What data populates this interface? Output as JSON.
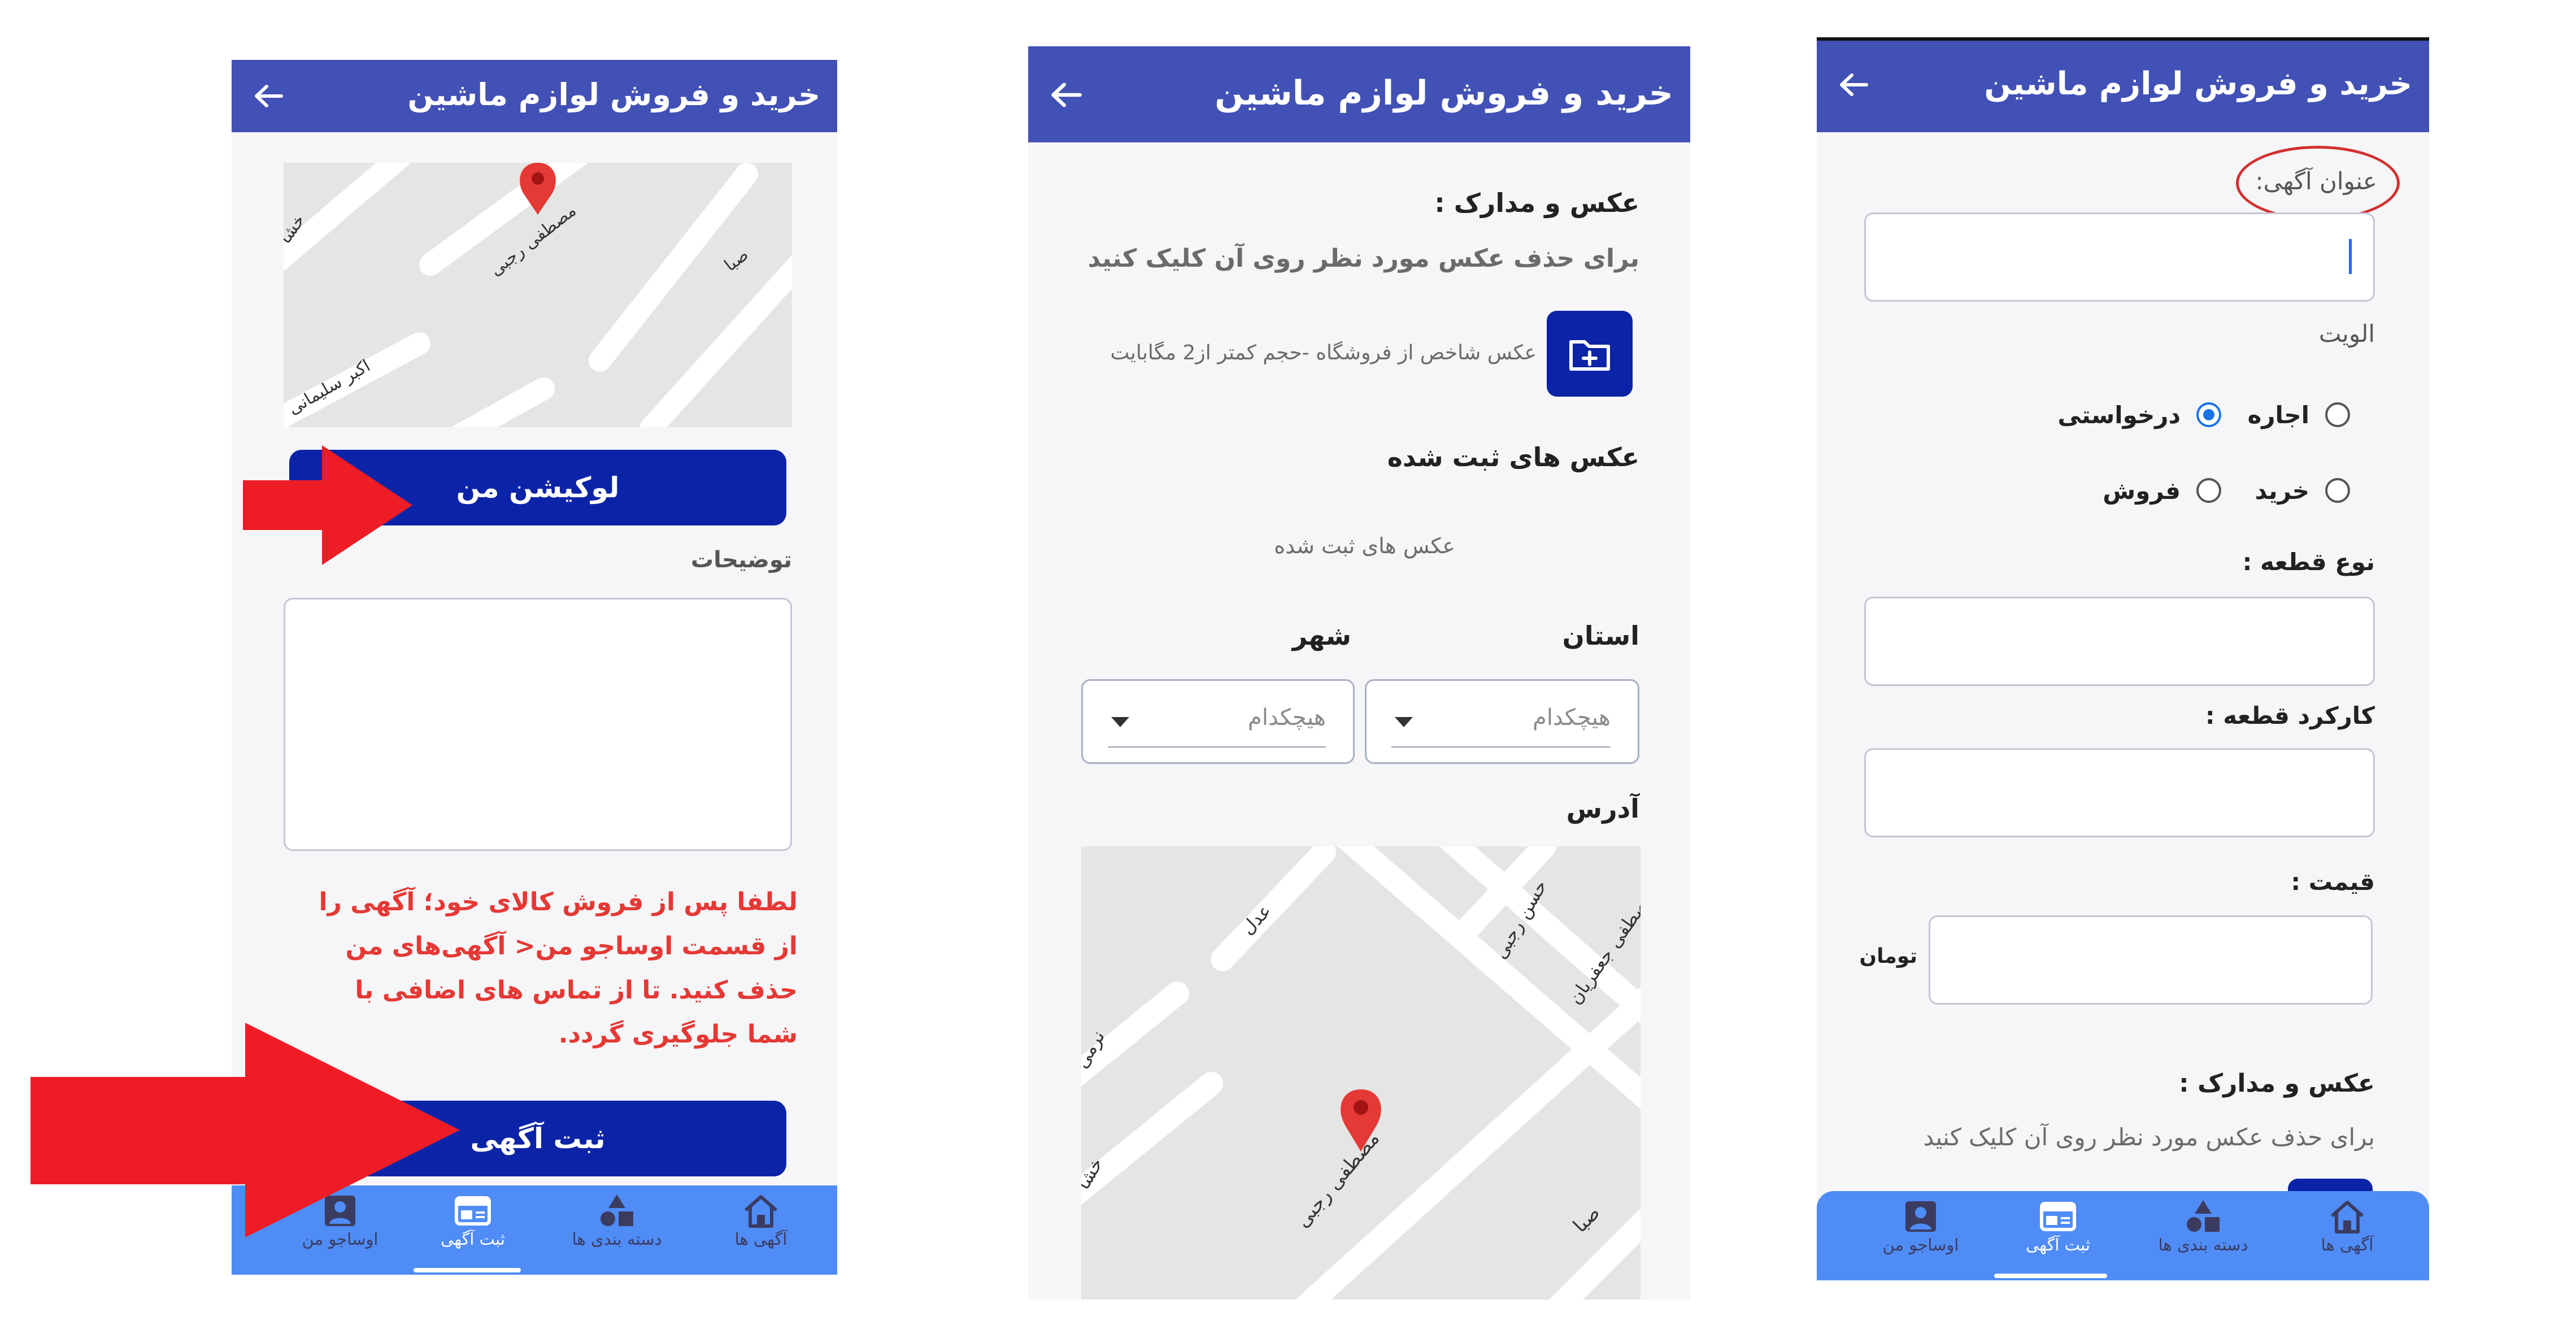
{
  "app": {
    "title": "خرید و فروش لوازم ماشین",
    "back_icon": "arrow-left-icon",
    "accent": "#4251b5",
    "nav_bg": "#4f8cf6",
    "button_bg": "#0b24a7"
  },
  "bottom_nav": {
    "items": [
      {
        "label": "آگهی ها",
        "icon": "home-icon"
      },
      {
        "label": "دسته بندی ها",
        "icon": "shapes-icon"
      },
      {
        "label": "ثبت آگهی",
        "icon": "ad-card-icon"
      },
      {
        "label": "اوساجو من",
        "icon": "person-icon"
      }
    ],
    "active_index": 2
  },
  "screen_right": {
    "title_label": "عنوان آگهی:",
    "priority_label": "الویت",
    "radios": [
      {
        "label": "اجاره",
        "selected": false
      },
      {
        "label": "درخواستی",
        "selected": true
      },
      {
        "label": "خرید",
        "selected": false
      },
      {
        "label": "فروش",
        "selected": false
      }
    ],
    "part_type_label": "نوع قطعه :",
    "part_usage_label": "کارکرد قطعه :",
    "price_label": "قیمت :",
    "currency": "تومان",
    "docs_label": "عکس و مدارک :",
    "docs_hint": "برای حذف عکس مورد نظر روی آن کلیک کنید"
  },
  "screen_middle": {
    "docs_label": "عکس و مدارک :",
    "docs_hint": "برای حذف عکس مورد نظر روی آن کلیک کنید",
    "upload_hint": "عکس شاخص از فروشگاه -حجم کمتر از2 مگابایت",
    "upload_icon": "folder-plus-icon",
    "saved_label": "عکس های ثبت شده",
    "saved_placeholder": "عکس های ثبت شده",
    "province_label": "استان",
    "city_label": "شهر",
    "province_value": "هیچکدام",
    "city_value": "هیچکدام",
    "address_label": "آدرس",
    "map_streets": [
      "حسن رجبی",
      "مصطفی جعفریان",
      "عدل",
      "نرمی",
      "مصطفی رجبی",
      "صبا",
      "خشا"
    ]
  },
  "screen_left": {
    "map_streets": [
      "مصطفی رجبی",
      "صبا",
      "اکبر سلیمانی",
      "خشا"
    ],
    "location_button": "لوکیشن من",
    "description_label": "توضیحات",
    "warning_text": "لطفا پس از فروش کالای خود؛ آگهی را از قسمت  اوساجو من< آگهی‌های من  حذف کنید. تا از تماس های اضافی با شما جلوگیری گردد.",
    "warning_color": "#e53935",
    "submit_button": "ثبت آگهی"
  }
}
